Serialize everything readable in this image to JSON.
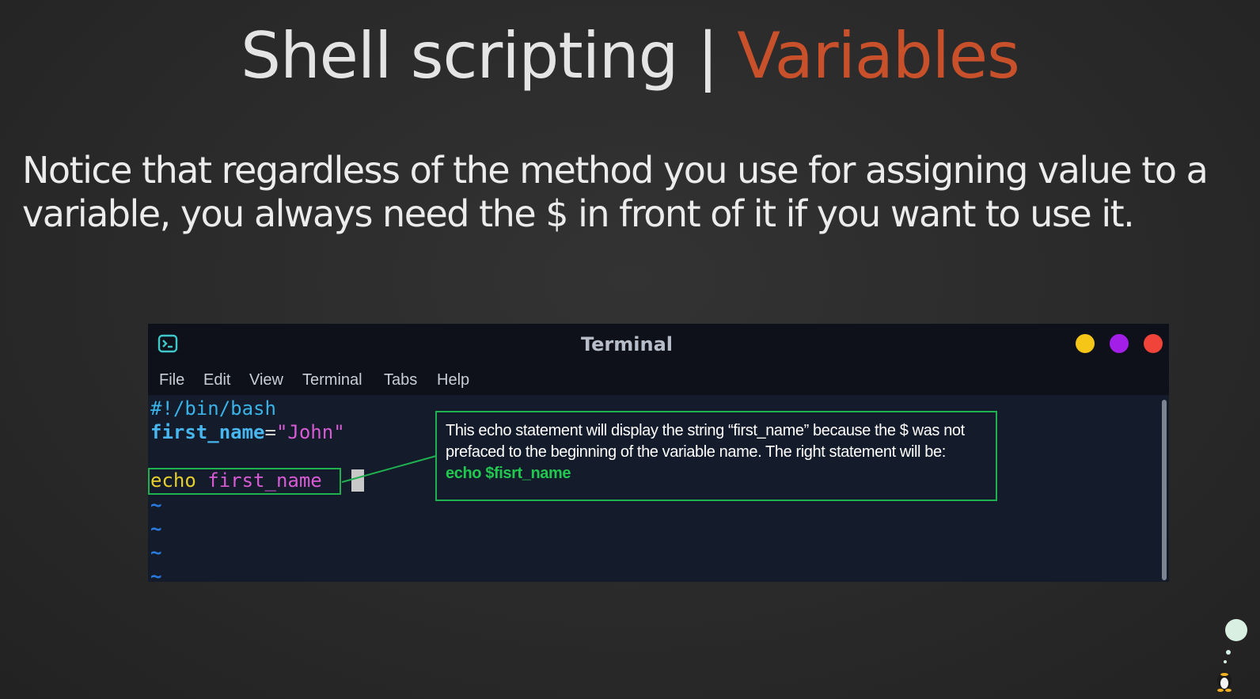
{
  "slide": {
    "title_main": "Shell scripting | ",
    "title_accent": "Variables",
    "subtitle": "Notice that regardless of the method you use for assigning value to a variable, you always need the $ in front of it if you want to use it."
  },
  "terminal": {
    "window_title": "Terminal",
    "menu": [
      "File",
      "Edit",
      "View",
      "Terminal",
      "Tabs",
      "Help"
    ],
    "lines": {
      "shebang": "#!/bin/bash",
      "var_name": "first_name",
      "equals": "=",
      "var_value": "\"John\"",
      "echo_cmd": "echo",
      "echo_arg": "first_name",
      "tilde": "~"
    }
  },
  "callout": {
    "text": "This echo statement will display the string “first_name” because the $ was not prefaced to the beginning of the variable name. The right statement will be:",
    "code": "echo $fisrt_name"
  },
  "colors": {
    "accent": "#c8502a",
    "highlight_green": "#1fb04f",
    "min_button": "#f5c518",
    "max_button": "#a31fe8",
    "close_button": "#f0433a"
  },
  "icons": {
    "terminal_app": "terminal-icon",
    "mascot": "tux-penguin-icon"
  }
}
